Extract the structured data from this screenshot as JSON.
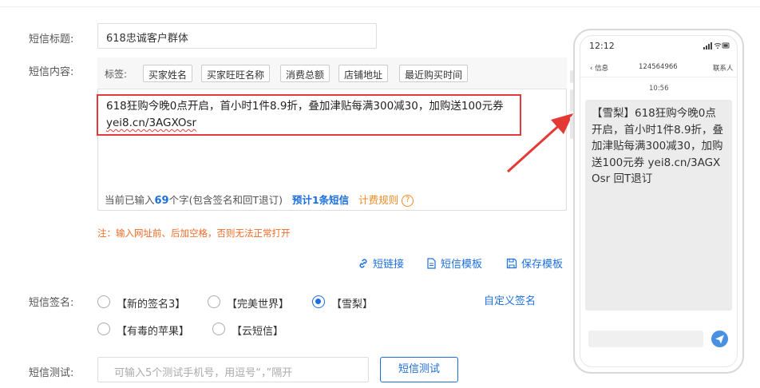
{
  "form": {
    "title_label": "短信标题:",
    "title_value": "618忠诚客户群体",
    "content_label": "短信内容:",
    "tags_label": "标签:",
    "tags": [
      "买家姓名",
      "买家旺旺名称",
      "消费总额",
      "店铺地址",
      "最近购买时间"
    ],
    "sms_text_line1": "618狂购今晚0点开启，首小时1件8.9折，叠加津贴每满300减30，加购送100元券",
    "sms_text_url": "yei8.cn/3AGXOsr",
    "count_prefix": "当前已输入",
    "count_value": "69",
    "count_suffix": "个字(包含签名和回T退订)",
    "estimate_prefix": "预计",
    "estimate_value": "1",
    "estimate_suffix": "条短信",
    "rule_label": "计费规则",
    "help_symbol": "?",
    "note": "注：输入网址前、后加空格，否则无法正常打开",
    "actions": [
      "短链接",
      "短信模板",
      "保存模板"
    ],
    "signature_label": "短信签名:",
    "signatures": [
      {
        "label": "【新的签名3】",
        "selected": false
      },
      {
        "label": "【完美世界】",
        "selected": false
      },
      {
        "label": "【雪梨】",
        "selected": true
      },
      {
        "label": "【有毒的苹果】",
        "selected": false
      },
      {
        "label": "【云短信】",
        "selected": false
      }
    ],
    "custom_signature": "自定义签名",
    "test_label": "短信测试:",
    "test_placeholder": "可输入5个测试手机号，用逗号“，”隔开",
    "test_button": "短信测试"
  },
  "phone": {
    "time": "12:12",
    "back_label": "信息",
    "number": "124564966",
    "contact": "联系人",
    "message_time": "10:56",
    "message": "【雪梨】618狂购今晚0点开启，首小时1件8.9折，叠加津贴每满300减30，加购送100元券  yei8.cn/3AGXOsr 回T退订"
  },
  "colors": {
    "accent": "#1d6fdc",
    "highlight_border": "#e23b3b",
    "warning": "#f06a24"
  }
}
